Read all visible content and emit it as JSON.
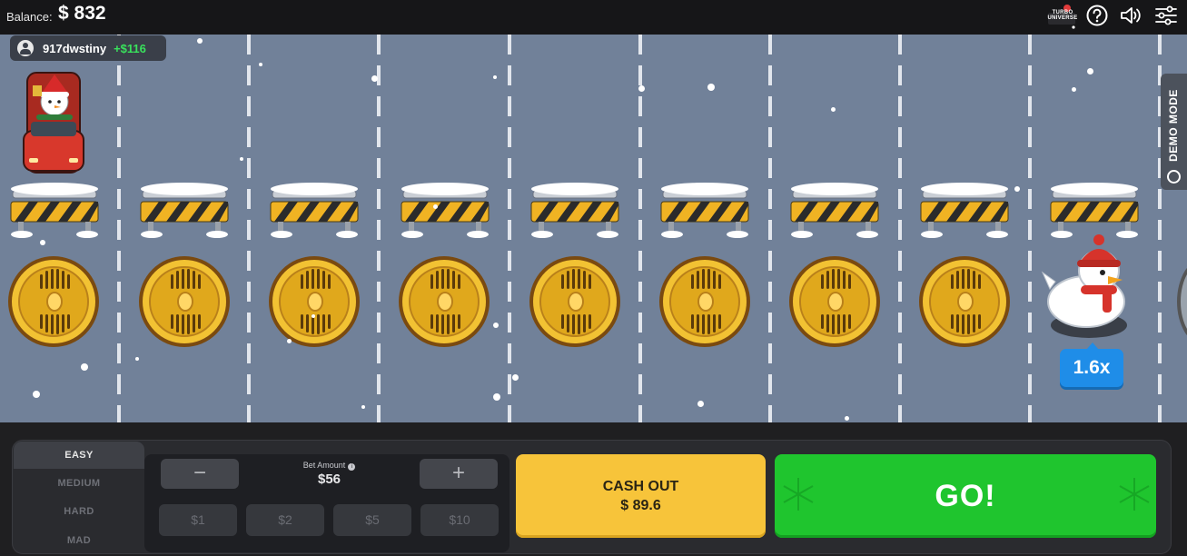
{
  "header": {
    "balance_label": "Balance:",
    "balance_value": "$ 832",
    "brand_text": "TURBO UNIVERSE"
  },
  "player": {
    "name": "917dwstiny",
    "win": "+$116"
  },
  "demo_mode_label": "DEMO MODE",
  "multiplier": "1.6x",
  "difficulty": {
    "items": [
      "EASY",
      "MEDIUM",
      "HARD",
      "MAD"
    ],
    "selected": "EASY"
  },
  "bet": {
    "label": "Bet Amount",
    "value": "$56",
    "minus": "−",
    "plus": "+",
    "chips": [
      "$1",
      "$2",
      "$5",
      "$10"
    ]
  },
  "cashout": {
    "label": "CASH OUT",
    "value": "$ 89.6"
  },
  "go_label": "GO!",
  "colors": {
    "road": "#718199",
    "cashout": "#f7c43a",
    "go": "#1fc52e",
    "multiplier": "#1f8de8",
    "win": "#39e25c"
  }
}
